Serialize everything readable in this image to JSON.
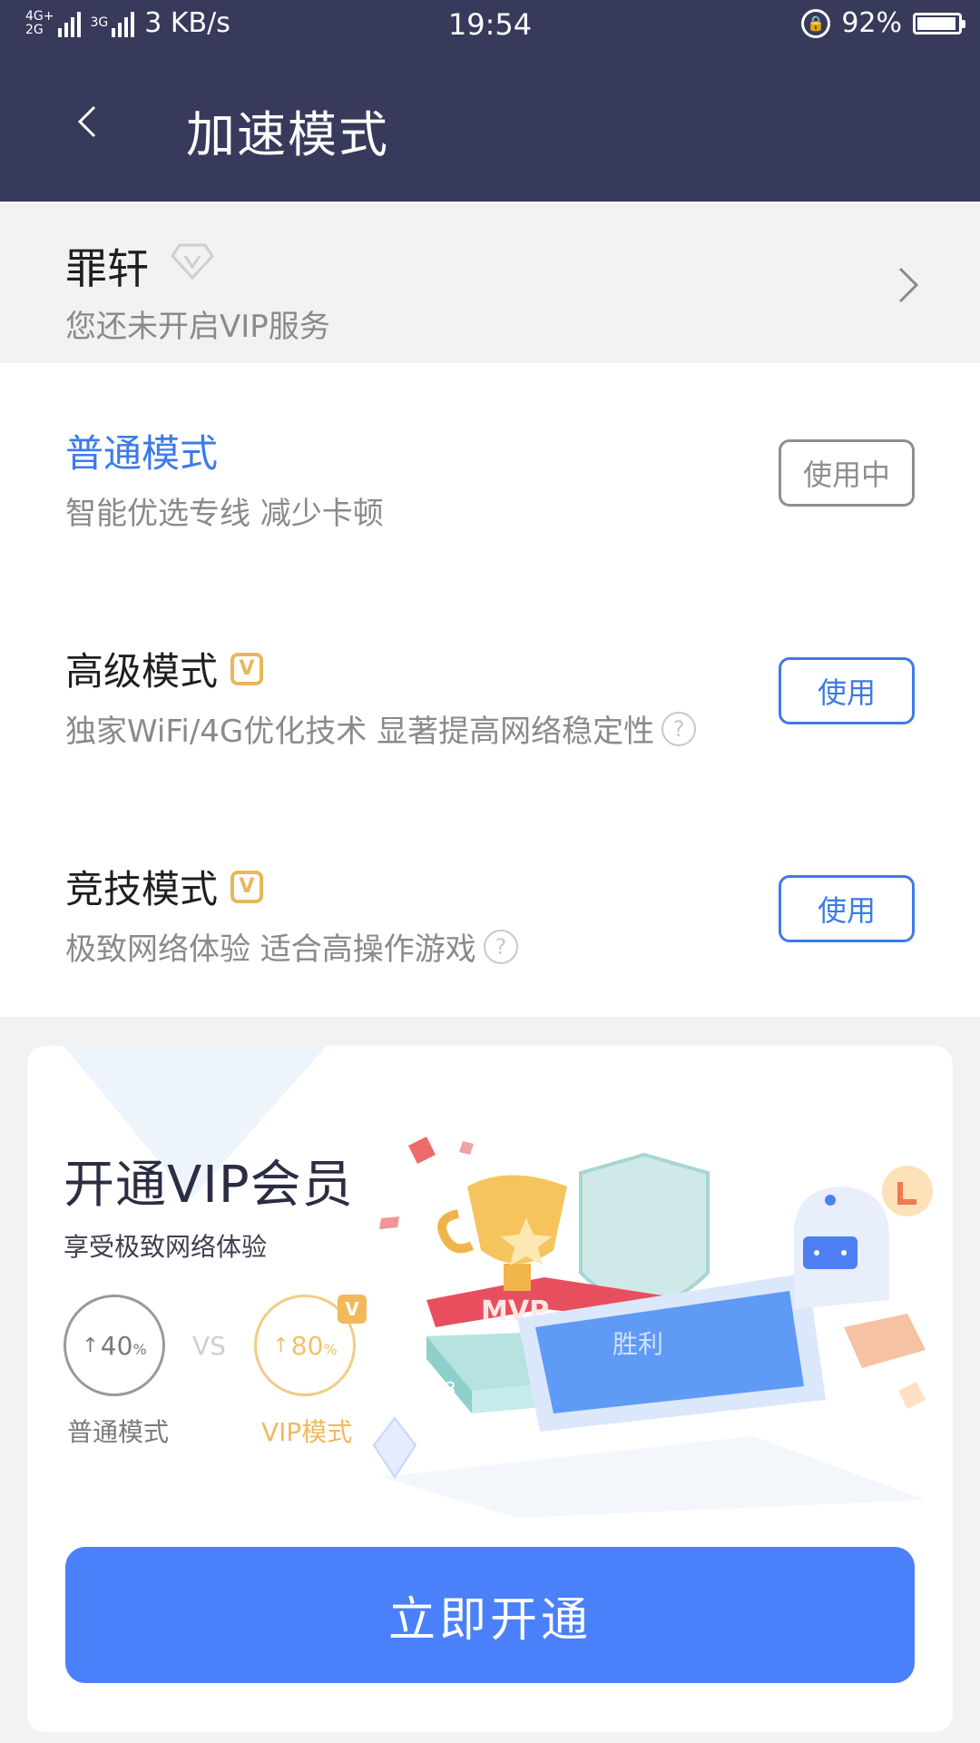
{
  "status_bar": {
    "net_a": "4G+",
    "net_b": "2G",
    "net_c": "3G",
    "speed": "3 KB/s",
    "time": "19:54",
    "battery": "92%"
  },
  "header": {
    "title": "加速模式"
  },
  "user": {
    "name": "罪轩",
    "vip_status": "您还未开启VIP服务"
  },
  "modes": [
    {
      "name": "普通模式",
      "desc": "智能优选专线 减少卡顿",
      "button": "使用中",
      "vip": false,
      "help": false,
      "active": true
    },
    {
      "name": "高级模式",
      "desc": "独家WiFi/4G优化技术 显著提高网络稳定性",
      "button": "使用",
      "vip": true,
      "help": true,
      "active": false
    },
    {
      "name": "竞技模式",
      "desc": "极致网络体验 适合高操作游戏",
      "button": "使用",
      "vip": true,
      "help": true,
      "active": false
    }
  ],
  "vip_card": {
    "title": "开通VIP会员",
    "subtitle": "享受极致网络体验",
    "normal_value": "40",
    "normal_unit": "%",
    "normal_label": "普通模式",
    "vs": "VS",
    "vip_value": "80",
    "vip_unit": "%",
    "vip_label": "VIP模式",
    "badge_letter": "V",
    "illus_mvp": "MVP",
    "illus_win": "胜利",
    "illus_first": "1",
    "illus_third": "3",
    "cta": "立即开通"
  },
  "colors": {
    "header_bg": "#373a5a",
    "accent_blue": "#3a7bea",
    "cta_blue": "#4b80fb",
    "vip_gold": "#e8b75a"
  }
}
